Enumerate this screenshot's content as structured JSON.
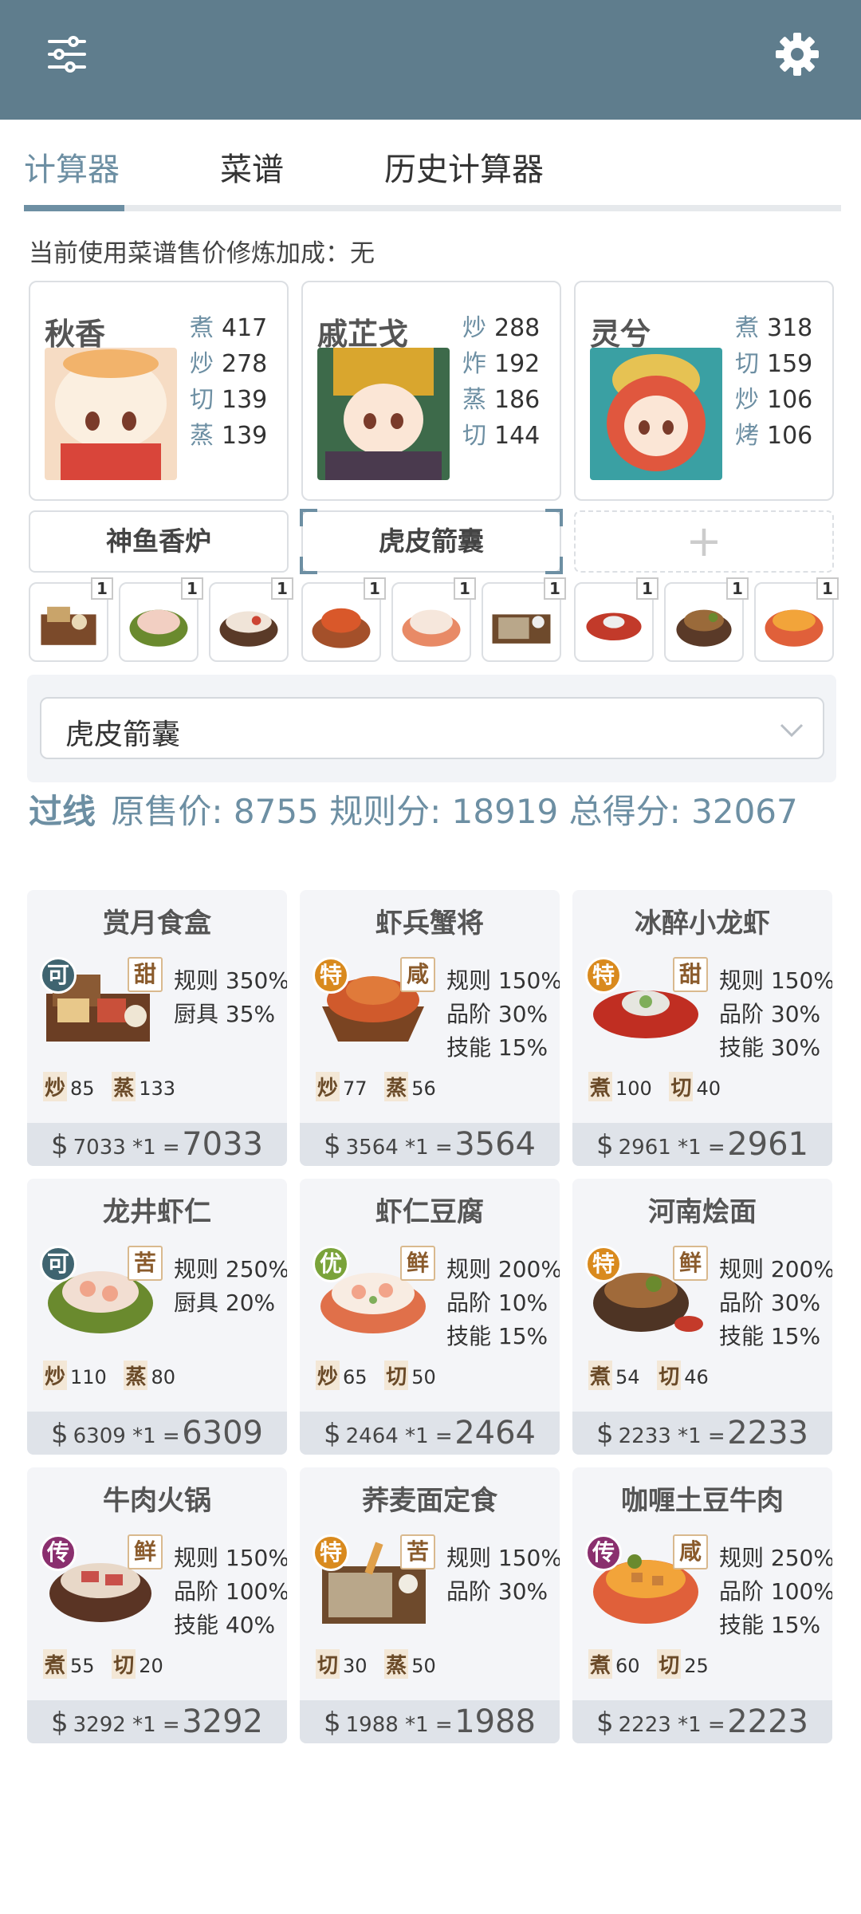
{
  "header": {
    "menu_icon": "sliders-icon",
    "settings_icon": "gear-icon"
  },
  "tabs": [
    "计算器",
    "菜谱",
    "历史计算器"
  ],
  "bonus_line": "当前使用菜谱售价修炼加成：无",
  "chefs": [
    {
      "name": "秋香",
      "stats": [
        [
          "煮",
          "417"
        ],
        [
          "炒",
          "278"
        ],
        [
          "切",
          "139"
        ],
        [
          "蒸",
          "139"
        ]
      ]
    },
    {
      "name": "戚芷戈",
      "stats": [
        [
          "炒",
          "288"
        ],
        [
          "炸",
          "192"
        ],
        [
          "蒸",
          "186"
        ],
        [
          "切",
          "144"
        ]
      ]
    },
    {
      "name": "灵兮",
      "stats": [
        [
          "煮",
          "318"
        ],
        [
          "切",
          "159"
        ],
        [
          "炒",
          "106"
        ],
        [
          "烤",
          "106"
        ]
      ]
    }
  ],
  "equipment": [
    "神鱼香炉",
    "虎皮箭囊",
    "+"
  ],
  "dish_counts": [
    "1",
    "1",
    "1",
    "1",
    "1",
    "1",
    "1",
    "1",
    "1"
  ],
  "selected_item": "虎皮箭囊",
  "summary": {
    "pass": "过线",
    "label_original": "原售价:",
    "original": "8755",
    "label_rule": "规则分:",
    "rule": "18919",
    "label_total": "总得分:",
    "total": "32067"
  },
  "recipes": [
    {
      "name": "赏月食盒",
      "rarity": "可",
      "flavor": "甜",
      "bonuses": [
        "规则 350%",
        "厨具 35%"
      ],
      "skills": [
        [
          "炒",
          "85"
        ],
        [
          "蒸",
          "133"
        ]
      ],
      "price": "7033 *1 =",
      "total": "7033"
    },
    {
      "name": "虾兵蟹将",
      "rarity": "特",
      "flavor": "咸",
      "bonuses": [
        "规则 150%",
        "品阶 30%",
        "技能 15%"
      ],
      "skills": [
        [
          "炒",
          "77"
        ],
        [
          "蒸",
          "56"
        ]
      ],
      "price": "3564 *1 =",
      "total": "3564"
    },
    {
      "name": "冰醉小龙虾",
      "rarity": "特",
      "flavor": "甜",
      "bonuses": [
        "规则 150%",
        "品阶 30%",
        "技能 30%"
      ],
      "skills": [
        [
          "煮",
          "100"
        ],
        [
          "切",
          "40"
        ]
      ],
      "price": "2961 *1 =",
      "total": "2961"
    },
    {
      "name": "龙井虾仁",
      "rarity": "可",
      "flavor": "苦",
      "bonuses": [
        "规则 250%",
        "厨具 20%"
      ],
      "skills": [
        [
          "炒",
          "110"
        ],
        [
          "蒸",
          "80"
        ]
      ],
      "price": "6309 *1 =",
      "total": "6309"
    },
    {
      "name": "虾仁豆腐",
      "rarity": "优",
      "flavor": "鲜",
      "bonuses": [
        "规则 200%",
        "品阶 10%",
        "技能 15%"
      ],
      "skills": [
        [
          "炒",
          "65"
        ],
        [
          "切",
          "50"
        ]
      ],
      "price": "2464 *1 =",
      "total": "2464"
    },
    {
      "name": "河南烩面",
      "rarity": "特",
      "flavor": "鲜",
      "bonuses": [
        "规则 200%",
        "品阶 30%",
        "技能 15%"
      ],
      "skills": [
        [
          "煮",
          "54"
        ],
        [
          "切",
          "46"
        ]
      ],
      "price": "2233 *1 =",
      "total": "2233"
    },
    {
      "name": "牛肉火锅",
      "rarity": "传",
      "flavor": "鲜",
      "bonuses": [
        "规则 150%",
        "品阶 100%",
        "技能 40%"
      ],
      "skills": [
        [
          "煮",
          "55"
        ],
        [
          "切",
          "20"
        ]
      ],
      "price": "3292 *1 =",
      "total": "3292"
    },
    {
      "name": "荞麦面定食",
      "rarity": "特",
      "flavor": "苦",
      "bonuses": [
        "规则 150%",
        "品阶 30%"
      ],
      "skills": [
        [
          "切",
          "30"
        ],
        [
          "蒸",
          "50"
        ]
      ],
      "price": "1988 *1 =",
      "total": "1988"
    },
    {
      "name": "咖喱土豆牛肉",
      "rarity": "传",
      "flavor": "咸",
      "bonuses": [
        "规则 250%",
        "品阶 100%",
        "技能 15%"
      ],
      "skills": [
        [
          "煮",
          "60"
        ],
        [
          "切",
          "25"
        ]
      ],
      "price": "2223 *1 =",
      "total": "2223"
    }
  ],
  "colors": {
    "header": "#5f7d8d",
    "accent": "#6d8fa3",
    "rarity_可": "#3f6470",
    "rarity_特": "#d98a1e",
    "rarity_优": "#7aa33a",
    "rarity_传": "#8a2f6e"
  }
}
